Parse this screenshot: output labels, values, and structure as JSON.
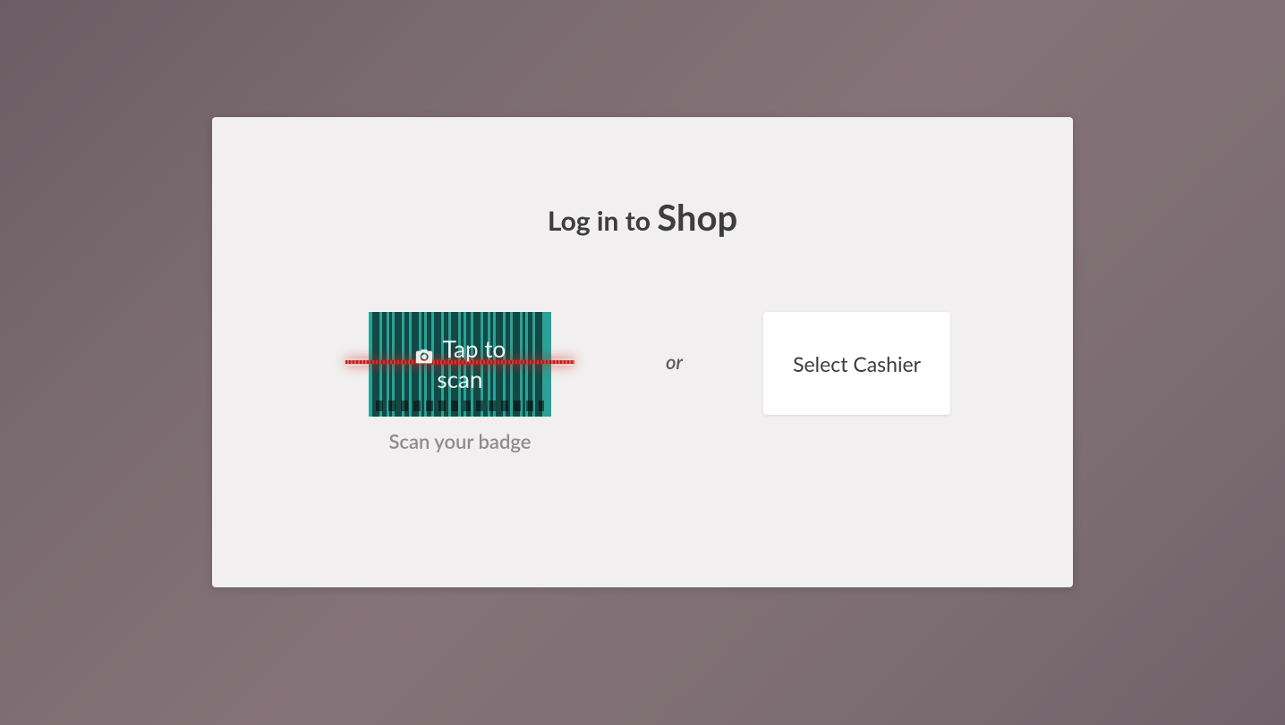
{
  "login": {
    "title_prefix": "Log in to ",
    "shop_name": "Shop",
    "scan": {
      "tap_label_line1": "Tap to",
      "tap_label_line2": "scan",
      "caption": "Scan your badge"
    },
    "or_label": "or",
    "select_cashier_label": "Select Cashier"
  }
}
